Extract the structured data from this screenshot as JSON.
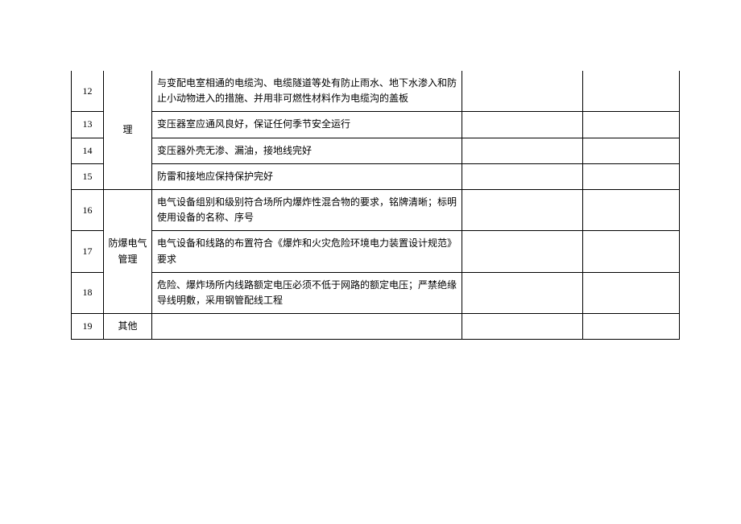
{
  "rows": [
    {
      "num": "12",
      "cat": "理",
      "content": "与变配电室相通的电缆沟、电缆隧道等处有防止雨水、地下水渗入和防止小动物进入的措施、并用非可燃性材料作为电缆沟的盖板"
    },
    {
      "num": "13",
      "cat": "",
      "content": "变压器室应通风良好，保证任何季节安全运行"
    },
    {
      "num": "14",
      "cat": "",
      "content": "变压器外壳无渗、漏油，接地线完好"
    },
    {
      "num": "15",
      "cat": "",
      "content": "防雷和接地应保持保护完好"
    },
    {
      "num": "16",
      "cat": "",
      "content": "电气设备组别和级别符合场所内爆炸性混合物的要求，铭牌清晰；标明使用设备的名称、序号"
    },
    {
      "num": "17",
      "cat": "防爆电气管理",
      "content": "电气设备和线路的布置符合《爆炸和火灾危险环境电力装置设计规范》要求"
    },
    {
      "num": "18",
      "cat": "",
      "content": "危险、爆炸场所内线路额定电压必须不低于网路的额定电压；严禁绝缘导线明敷，采用钢管配线工程"
    },
    {
      "num": "19",
      "cat": "其他",
      "content": ""
    }
  ]
}
